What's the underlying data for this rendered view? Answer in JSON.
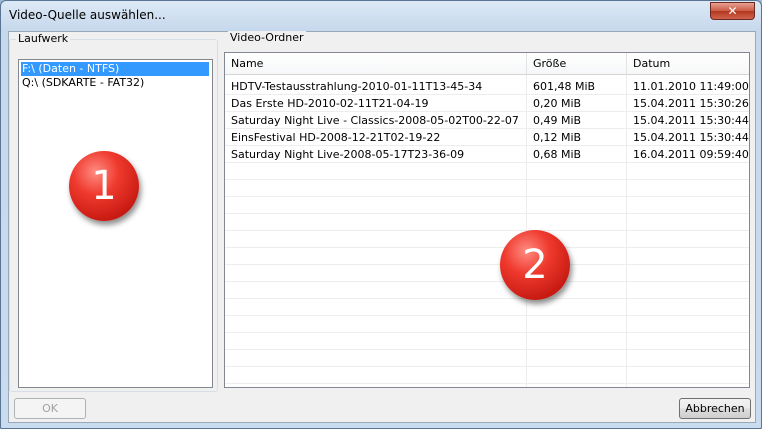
{
  "window": {
    "title": "Video-Quelle auswählen...",
    "close_glyph": "✕"
  },
  "drives": {
    "label": "Laufwerk",
    "items": [
      {
        "label": "F:\\ (Daten - NTFS)",
        "selected": true
      },
      {
        "label": "Q:\\ (SDKARTE - FAT32)",
        "selected": false
      }
    ]
  },
  "folders": {
    "label": "Video-Ordner",
    "columns": [
      "Name",
      "Größe",
      "Datum"
    ],
    "rows": [
      {
        "name": "HDTV-Testausstrahlung-2010-01-11T13-45-34",
        "size": "601,48 MiB",
        "date": "11.01.2010 11:49:00"
      },
      {
        "name": "Das Erste HD-2010-02-11T21-04-19",
        "size": "0,20 MiB",
        "date": "15.04.2011 15:30:26"
      },
      {
        "name": "Saturday Night Live - Classics-2008-05-02T00-22-07",
        "size": "0,49 MiB",
        "date": "15.04.2011 15:30:44"
      },
      {
        "name": "EinsFestival HD-2008-12-21T02-19-22",
        "size": "0,12 MiB",
        "date": "15.04.2011 15:30:44"
      },
      {
        "name": "Saturday Night Live-2008-05-17T23-36-09",
        "size": "0,68 MiB",
        "date": "16.04.2011 09:59:40"
      }
    ]
  },
  "badges": [
    "1",
    "2"
  ],
  "buttons": {
    "ok": "OK",
    "cancel": "Abbrechen"
  }
}
